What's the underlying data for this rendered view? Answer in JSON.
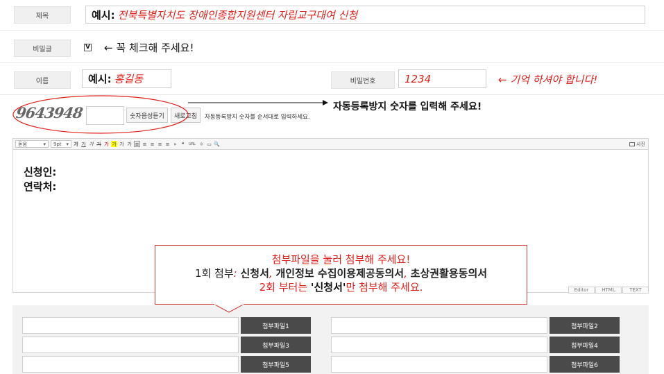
{
  "form": {
    "title_label": "제목",
    "title_example": "예시:",
    "title_value": "전북특별자치도 장애인종합지원센터 자립교구대여 신청",
    "secret_label": "비밀글",
    "secret_check": "V",
    "secret_note": "← 꼭 체크해 주세요!",
    "name_label": "이름",
    "name_example": "예시:",
    "name_value": "홍길동",
    "password_label": "비밀번호",
    "password_value": "1234",
    "password_note": "← 기억 하셔야 합니다!",
    "captcha_text": "9643948",
    "captcha_audio_btn": "숫자음성듣기",
    "captcha_refresh_btn": "새로고침",
    "captcha_hint": "자동등록방지 숫자를 순서대로 입력하세요.",
    "captcha_note": "자동등록방지 숫자를 입력해 주세요!"
  },
  "toolbar": {
    "font": "돋움",
    "size": "9pt",
    "photo": "사진",
    "icons": [
      "가",
      "가",
      "가",
      "가",
      "가",
      "가",
      "가",
      "가",
      "≡",
      "≡",
      "≡",
      "≡",
      "≡",
      "»",
      "❝",
      "URL",
      "☼",
      "▭",
      "🔍"
    ]
  },
  "editor": {
    "line1": "신청인:",
    "line2": "연락처:",
    "mode_tabs": [
      "Editor",
      "HTML",
      "TEXT"
    ]
  },
  "callout": {
    "line1": "첨부파일을 눌러 첨부해 주세요!",
    "line2_prefix": "1회 첨부",
    "line2_colon": ":",
    "line2_doc1": "신청서",
    "line2_sep1": ",",
    "line2_doc2": "개인정보 수집이용제공동의서",
    "line2_sep2": ",",
    "line2_doc3": "초상권활용동의서",
    "line3_prefix": "2회 부터는",
    "line3_quote": "'신청서'",
    "line3_suffix": "만 첨부해 주세요."
  },
  "attachments": [
    "첨부파일1",
    "첨부파일2",
    "첨부파일3",
    "첨부파일4",
    "첨부파일5",
    "첨부파일6"
  ],
  "colors": {
    "accent_red": "#e0201b",
    "button_dark": "#4a4a4a"
  }
}
